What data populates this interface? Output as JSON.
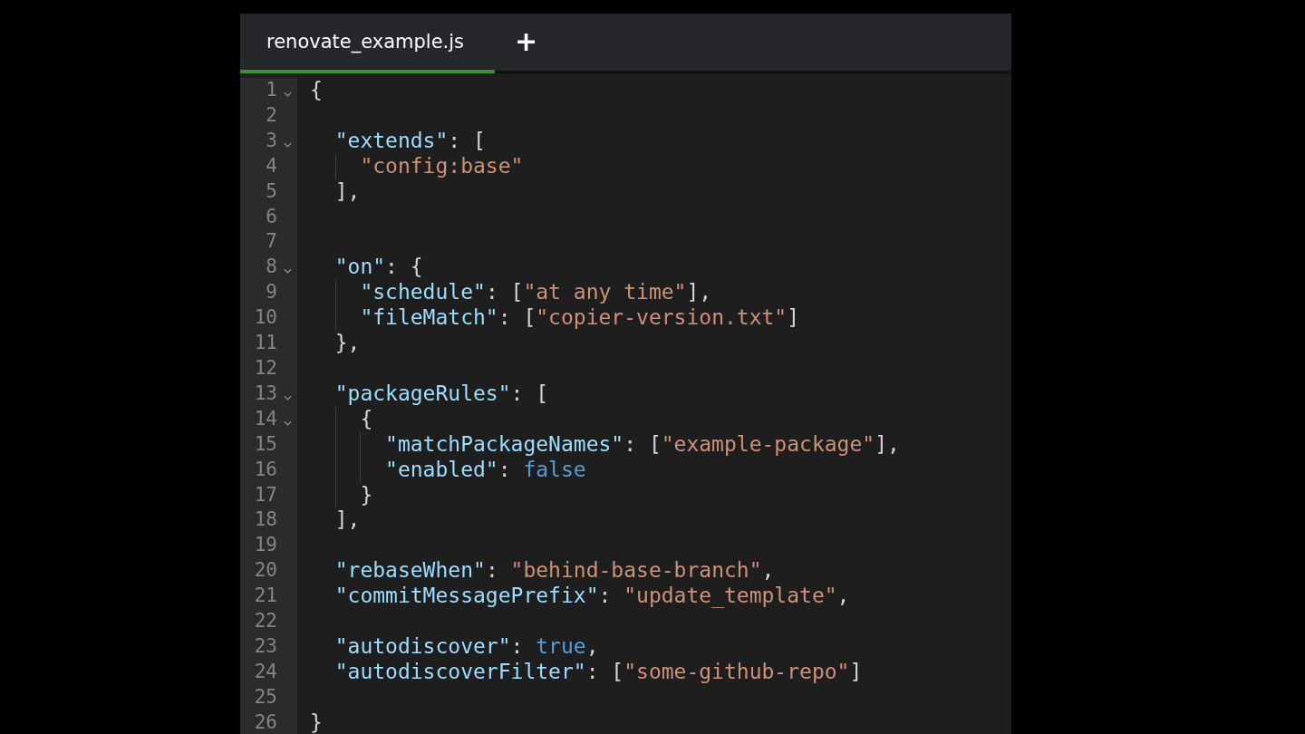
{
  "tabs": [
    {
      "label": "renovate_example.js",
      "selected": true
    }
  ],
  "new_tab": {
    "label": "+"
  },
  "lines": [
    {
      "number": "1",
      "fold": true,
      "tokens": [
        {
          "kind": "punct",
          "text": "{"
        }
      ]
    },
    {
      "number": "2",
      "fold": false
    },
    {
      "number": "3",
      "fold": true,
      "tokens": [
        {
          "kind": "key",
          "text": "  \"extends\""
        },
        {
          "kind": "punct",
          "text": ": ["
        }
      ]
    },
    {
      "number": "4",
      "fold": false,
      "tokens": [
        {
          "kind": "string",
          "text": "    \"config:base\""
        }
      ]
    },
    {
      "number": "5",
      "fold": false,
      "tokens": [
        {
          "kind": "punct",
          "text": "  ],"
        }
      ]
    },
    {
      "number": "6",
      "fold": false
    },
    {
      "number": "7",
      "fold": false
    },
    {
      "number": "8",
      "fold": true,
      "tokens": [
        {
          "kind": "key",
          "text": "  \"on\""
        },
        {
          "kind": "punct",
          "text": ": {"
        }
      ]
    },
    {
      "number": "9",
      "fold": false,
      "tokens": [
        {
          "kind": "key",
          "text": "    \"schedule\""
        },
        {
          "kind": "punct",
          "text": ": ["
        },
        {
          "kind": "string",
          "text": "\"at any time\""
        },
        {
          "kind": "punct",
          "text": "],"
        }
      ]
    },
    {
      "number": "10",
      "fold": false,
      "tokens": [
        {
          "kind": "key",
          "text": "    \"fileMatch\""
        },
        {
          "kind": "punct",
          "text": ": ["
        },
        {
          "kind": "string",
          "text": "\"copier-version.txt\""
        },
        {
          "kind": "punct",
          "text": "]"
        }
      ]
    },
    {
      "number": "11",
      "fold": false,
      "tokens": [
        {
          "kind": "punct",
          "text": "  },"
        }
      ]
    },
    {
      "number": "12",
      "fold": false
    },
    {
      "number": "13",
      "fold": true,
      "tokens": [
        {
          "kind": "key",
          "text": "  \"packageRules\""
        },
        {
          "kind": "punct",
          "text": ": ["
        }
      ]
    },
    {
      "number": "14",
      "fold": true,
      "tokens": [
        {
          "kind": "punct",
          "text": "    {"
        }
      ]
    },
    {
      "number": "15",
      "fold": false,
      "tokens": [
        {
          "kind": "key",
          "text": "      \"matchPackageNames\""
        },
        {
          "kind": "punct",
          "text": ": ["
        },
        {
          "kind": "string",
          "text": "\"example-package\""
        },
        {
          "kind": "punct",
          "text": "],"
        }
      ]
    },
    {
      "number": "16",
      "fold": false,
      "tokens": [
        {
          "kind": "key",
          "text": "      \"enabled\""
        },
        {
          "kind": "punct",
          "text": ": "
        },
        {
          "kind": "literal",
          "text": "false"
        }
      ]
    },
    {
      "number": "17",
      "fold": false,
      "tokens": [
        {
          "kind": "punct",
          "text": "    }"
        }
      ]
    },
    {
      "number": "18",
      "fold": false,
      "tokens": [
        {
          "kind": "punct",
          "text": "  ],"
        }
      ]
    },
    {
      "number": "19",
      "fold": false
    },
    {
      "number": "20",
      "fold": false,
      "tokens": [
        {
          "kind": "key",
          "text": "  \"rebaseWhen\""
        },
        {
          "kind": "punct",
          "text": ": "
        },
        {
          "kind": "string",
          "text": "\"behind-base-branch\""
        },
        {
          "kind": "punct",
          "text": ","
        }
      ]
    },
    {
      "number": "21",
      "fold": false,
      "tokens": [
        {
          "kind": "key",
          "text": "  \"commitMessagePrefix\""
        },
        {
          "kind": "punct",
          "text": ": "
        },
        {
          "kind": "string",
          "text": "\"update_template\""
        },
        {
          "kind": "punct",
          "text": ","
        }
      ]
    },
    {
      "number": "22",
      "fold": false
    },
    {
      "number": "23",
      "fold": false,
      "tokens": [
        {
          "kind": "key",
          "text": "  \"autodiscover\""
        },
        {
          "kind": "punct",
          "text": ": "
        },
        {
          "kind": "literal",
          "text": "true"
        },
        {
          "kind": "punct",
          "text": ","
        }
      ]
    },
    {
      "number": "24",
      "fold": false,
      "tokens": [
        {
          "kind": "key",
          "text": "  \"autodiscoverFilter\""
        },
        {
          "kind": "punct",
          "text": ": ["
        },
        {
          "kind": "string",
          "text": "\"some-github-repo\""
        },
        {
          "kind": "punct",
          "text": "]"
        }
      ]
    },
    {
      "number": "25",
      "fold": false
    },
    {
      "number": "26",
      "fold": false,
      "tokens": [
        {
          "kind": "punct",
          "text": "}"
        }
      ]
    }
  ]
}
